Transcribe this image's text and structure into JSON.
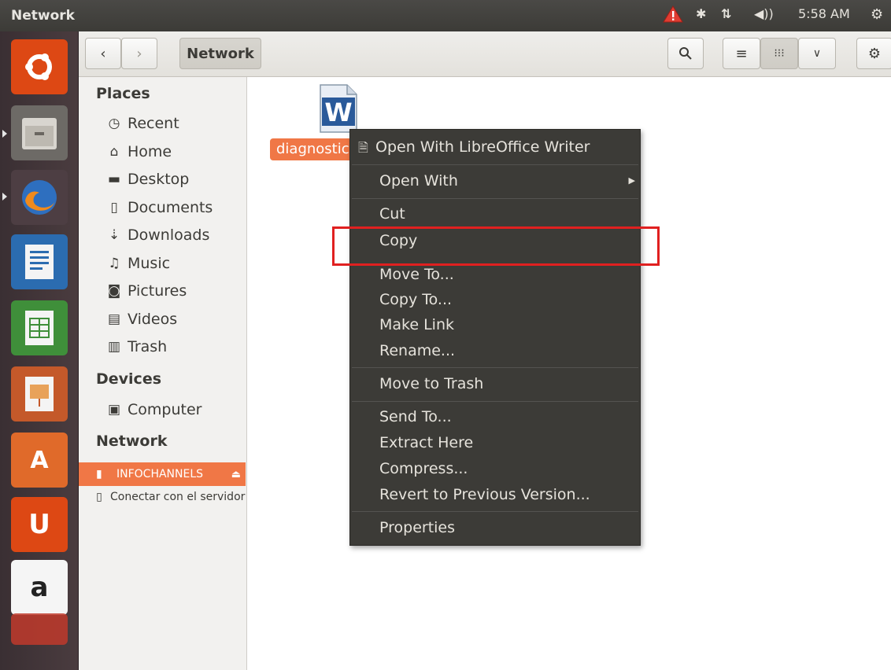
{
  "window": {
    "title": "Network"
  },
  "panel": {
    "time": "5:58 AM"
  },
  "toolbar": {
    "path_button": "Network"
  },
  "sidebar": {
    "places_header": "Places",
    "places": [
      {
        "label": "Recent",
        "icon": "clock-icon"
      },
      {
        "label": "Home",
        "icon": "home-icon"
      },
      {
        "label": "Desktop",
        "icon": "folder-icon"
      },
      {
        "label": "Documents",
        "icon": "document-icon"
      },
      {
        "label": "Downloads",
        "icon": "download-icon"
      },
      {
        "label": "Music",
        "icon": "music-icon"
      },
      {
        "label": "Pictures",
        "icon": "camera-icon"
      },
      {
        "label": "Videos",
        "icon": "film-icon"
      },
      {
        "label": "Trash",
        "icon": "trash-icon"
      }
    ],
    "devices_header": "Devices",
    "devices": [
      {
        "label": "Computer",
        "icon": "computer-icon"
      }
    ],
    "network_header": "Network",
    "network": [
      {
        "label": "INFOCHANNELS",
        "icon": "network-share-icon"
      },
      {
        "label": "Conectar con el servidor",
        "icon": "connect-server-icon"
      }
    ]
  },
  "content": {
    "file_label": "diagnostic"
  },
  "context_menu": {
    "open_with_writer": "Open With LibreOffice Writer",
    "open_with": "Open With",
    "cut": "Cut",
    "copy": "Copy",
    "move_to": "Move To...",
    "copy_to": "Copy To...",
    "make_link": "Make Link",
    "rename": "Rename...",
    "move_to_trash": "Move to Trash",
    "send_to": "Send To...",
    "extract_here": "Extract Here",
    "compress": "Compress...",
    "revert": "Revert to Previous Version...",
    "properties": "Properties"
  },
  "colors": {
    "accent": "#f07746",
    "highlight_box": "#e02020",
    "menu_bg": "#3c3b37"
  }
}
